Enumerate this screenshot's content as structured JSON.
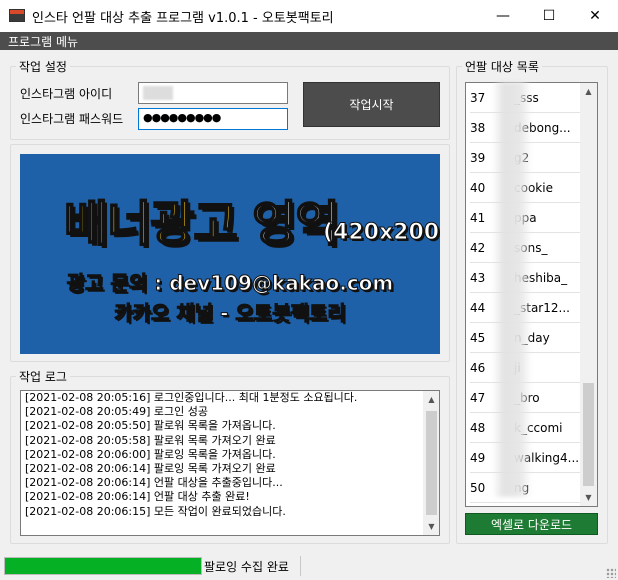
{
  "window": {
    "title": "인스타 언팔 대상 추출 프로그램 v1.0.1 - 오토봇팩토리",
    "minimize_icon": "minimize-icon",
    "maximize_icon": "maximize-icon",
    "close_icon": "close-icon"
  },
  "menu": {
    "program_menu": "프로그램 메뉴"
  },
  "settings": {
    "group_label": "작업 설정",
    "id_label": "인스타그램 아이디",
    "pw_label": "인스타그램 패스워드",
    "password_mask": "●●●●●●●●●",
    "start_button": "작업시작"
  },
  "banner": {
    "title_main": "배너광고",
    "title_sub": "영역",
    "size_text": "(420x200)",
    "line1": "광고 문의 : dev109@kakao.com",
    "line2": "카카오 채널 - 오토봇팩토리"
  },
  "log": {
    "group_label": "작업 로그",
    "lines": [
      "[2021-02-08 20:05:16] 로그인중입니다... 최대 1분정도 소요됩니다.",
      "[2021-02-08 20:05:49] 로그인 성공",
      "[2021-02-08 20:05:50] 팔로워 목록을 가져옵니다.",
      "[2021-02-08 20:05:58] 팔로워 목록 가져오기 완료",
      "[2021-02-08 20:06:00] 팔로잉 목록을 가져옵니다.",
      "[2021-02-08 20:06:14] 팔로잉 목록 가져오기 완료",
      "[2021-02-08 20:06:14] 언팔 대상을 추출중입니다...",
      "[2021-02-08 20:06:14] 언팔 대상 추출 완료!",
      "[2021-02-08 20:06:15] 모든 작업이 완료되었습니다."
    ]
  },
  "unfollow": {
    "group_label": "언팔 대상 목록",
    "items": [
      {
        "num": "37",
        "name": "_sss"
      },
      {
        "num": "38",
        "name": "debong..."
      },
      {
        "num": "39",
        "name": "g2"
      },
      {
        "num": "40",
        "name": "cookie"
      },
      {
        "num": "41",
        "name": "ppa"
      },
      {
        "num": "42",
        "name": "sons_"
      },
      {
        "num": "43",
        "name": "heshiba_"
      },
      {
        "num": "44",
        "name": "_star12..."
      },
      {
        "num": "45",
        "name": "n_day"
      },
      {
        "num": "46",
        "name": "ji"
      },
      {
        "num": "47",
        "name": "_bro"
      },
      {
        "num": "48",
        "name": "k_ccomi"
      },
      {
        "num": "49",
        "name": "walking4..."
      },
      {
        "num": "50",
        "name": "ng"
      }
    ],
    "excel_button": "엑셀로 다운로드"
  },
  "status": {
    "progress_percent": 100,
    "text": "팔로잉 수집 완료"
  },
  "colors": {
    "banner_bg": "#1f61a8",
    "banner_title": "#ffd21e",
    "progress": "#06b025",
    "excel_button": "#1e7b34",
    "start_button": "#4c4c4c",
    "menubar": "#4d4d4d"
  }
}
